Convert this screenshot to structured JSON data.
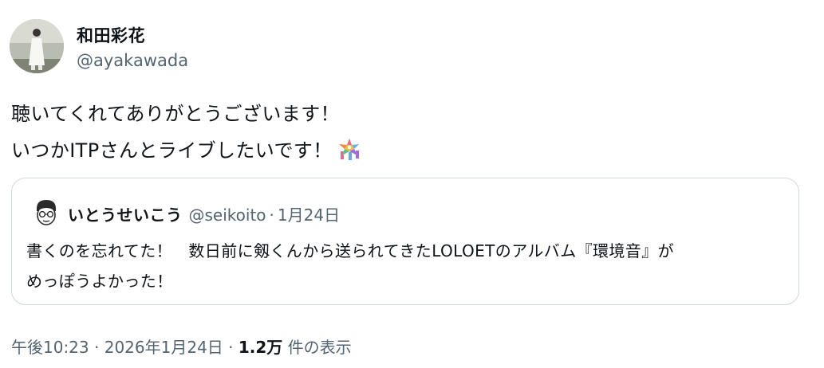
{
  "author": {
    "display_name": "和田彩花",
    "handle": "@ayakawada"
  },
  "tweet": {
    "line1": "聴いてくれてありがとうございます！",
    "line2": "いつかITPさんとライブしたいです！",
    "emoji": "pinata-emoji"
  },
  "quote": {
    "display_name": "いとうせいこう",
    "handle": "@seikoito",
    "separator": "·",
    "date": "1月24日",
    "line1": "書くのを忘れてた！　数日前に剱くんから送られてきたLOLOETのアルバム『環境音』が",
    "line2": "めっぽうよかった！"
  },
  "meta": {
    "time": "午後10:23",
    "sep1": "·",
    "date": "2026年1月24日",
    "sep2": "·",
    "views_count": "1.2万",
    "views_label": "件の表示"
  },
  "colors": {
    "text": "#0f1419",
    "secondary": "#536471",
    "border": "#cfd9de"
  }
}
